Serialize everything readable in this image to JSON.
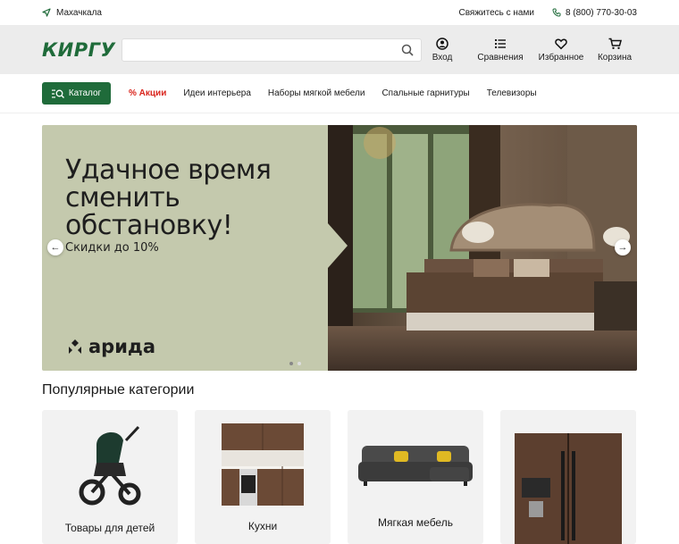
{
  "topbar": {
    "city": "Махачкала",
    "contact": "Свяжитесь с нами",
    "phone": "8 (800) 770-30-03"
  },
  "header": {
    "logo": "КИРГУ",
    "search_placeholder": "",
    "icons": [
      {
        "label": "Вход",
        "icon": "user-icon"
      },
      {
        "label": "Сравнения",
        "icon": "compare-icon"
      },
      {
        "label": "Избранное",
        "icon": "heart-icon"
      },
      {
        "label": "Корзина",
        "icon": "cart-icon"
      }
    ]
  },
  "nav": {
    "catalog": "Каталог",
    "links": [
      "% Акции",
      "Идеи интерьера",
      "Наборы мягкой мебели",
      "Спальные гарнитуры",
      "Телевизоры"
    ]
  },
  "banner": {
    "headline": [
      "Удачное время",
      "сменить",
      "обстановку!"
    ],
    "discount": "Скидки до 10%",
    "brand": "арида",
    "colors": {
      "panel": "#c4c9ad"
    }
  },
  "categories": {
    "title": "Популярные категории",
    "items": [
      "Товары для детей",
      "Кухни",
      "Мягкая мебель",
      ""
    ]
  },
  "colors": {
    "brand_green": "#1f6b3a",
    "sale_red": "#d9251d",
    "header_bg": "#ececec"
  }
}
